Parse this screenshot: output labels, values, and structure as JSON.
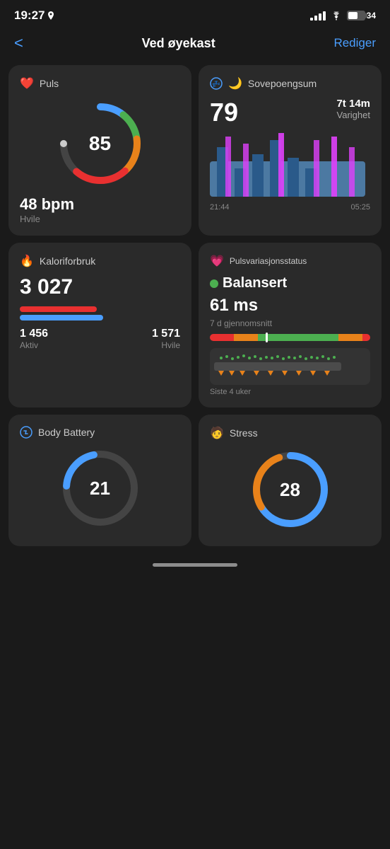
{
  "statusBar": {
    "time": "19:27",
    "battery": "34"
  },
  "nav": {
    "backLabel": "<",
    "title": "Ved øyekast",
    "editLabel": "Rediger"
  },
  "puls": {
    "title": "Puls",
    "value": "85",
    "bpm": "48 bpm",
    "label": "Hvile"
  },
  "sleep": {
    "title": "Sovepoengsum",
    "score": "79",
    "durationTime": "7t 14m",
    "durationLabel": "Varighet",
    "timeStart": "21:44",
    "timeEnd": "05:25"
  },
  "kalori": {
    "title": "Kaloriforbruk",
    "total": "3 027",
    "aktiv": "1 456",
    "aktivLabel": "Aktiv",
    "hvile": "1 571",
    "hvileLabel": "Hvile"
  },
  "hrv": {
    "title": "Pulsvariasjonsstatus",
    "statusDot": "green",
    "status": "Balansert",
    "value": "61 ms",
    "avgLabel": "7 d gjennomsnitt",
    "weeksLabel": "Siste 4 uker"
  },
  "bodyBattery": {
    "title": "Body Battery",
    "value": "21"
  },
  "stress": {
    "title": "Stress",
    "value": "28"
  }
}
